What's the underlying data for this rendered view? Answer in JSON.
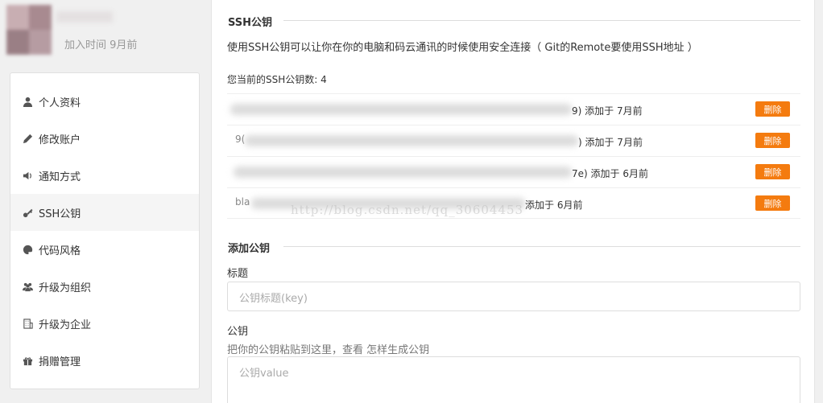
{
  "profile": {
    "joined": "加入时间 9月前"
  },
  "sidebar": {
    "items": [
      {
        "label": "个人资料",
        "icon": "user-icon"
      },
      {
        "label": "修改账户",
        "icon": "pencil-icon"
      },
      {
        "label": "通知方式",
        "icon": "volume-icon"
      },
      {
        "label": "SSH公钥",
        "icon": "key-icon"
      },
      {
        "label": "代码风格",
        "icon": "palette-icon"
      },
      {
        "label": "升级为组织",
        "icon": "group-icon"
      },
      {
        "label": "升级为企业",
        "icon": "building-icon"
      },
      {
        "label": "捐赠管理",
        "icon": "gift-icon"
      }
    ],
    "active": "SSH公钥"
  },
  "ssh": {
    "title": "SSH公钥",
    "description": "使用SSH公钥可以让你在你的电脑和码云通讯的时候使用安全连接（ Git的Remote要使用SSH地址 ）",
    "count_text": "您当前的SSH公钥数: 4",
    "keys": [
      {
        "prefix": "",
        "added": "9) 添加于 7月前",
        "delete": "删除"
      },
      {
        "prefix": "9(",
        "added": ") 添加于 7月前",
        "delete": "删除"
      },
      {
        "prefix": "",
        "added": "7e) 添加于 6月前",
        "delete": "删除"
      },
      {
        "prefix": "bla",
        "added": "添加于 6月前",
        "delete": "删除"
      }
    ]
  },
  "watermark": "http://blog.csdn.net/qq_30604453",
  "add_key": {
    "title": "添加公钥",
    "title_label": "标题",
    "title_placeholder": "公钥标题(key)",
    "key_label": "公钥",
    "hint_text": "把你的公钥粘贴到这里，查看 ",
    "hint_link": "怎样生成公钥",
    "key_placeholder": "公钥value"
  },
  "colors": {
    "delete_button": "#f47b0f",
    "active_nav_bg": "#f5f5f5"
  }
}
